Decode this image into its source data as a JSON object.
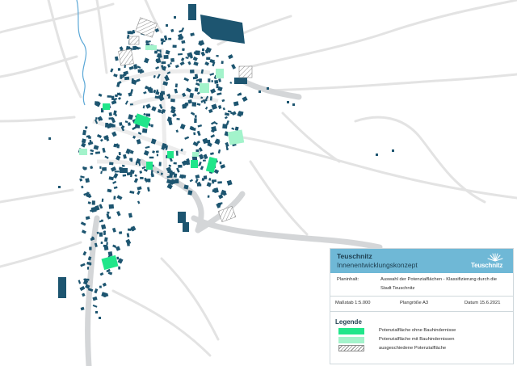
{
  "map": {
    "colors": {
      "background": "#ffffff",
      "roads": "#e3e3e3",
      "main_roads": "#d4d6d8",
      "buildings": "#1d5570",
      "water": "#5aa7d6",
      "potential_free": "#20e68a",
      "potential_obstacles": "#a3f3cb",
      "excluded_hatch": "#8c8c8c"
    }
  },
  "titleblock": {
    "title": "Teuschnitz",
    "subtitle": "Innenentwicklungskonzept",
    "logo_text": "Teuschnitz",
    "plan_label": "Planinhalt:",
    "plan_text_1": "Auswahl der Potenzialflächen - Klassifizierung durch die",
    "plan_text_2": "Stadt Teuschnitz",
    "scale": "Maßstab 1:5.000",
    "size": "Plangröße A3",
    "date": "Datum 15.6.2021",
    "colors": {
      "header": "#6fb8d6",
      "header_text": "#1d3d4e"
    }
  },
  "legend": {
    "title": "Legende",
    "items": [
      {
        "label": "Potenzialfläche ohne Bauhindernisse",
        "swatch": "#20e68a"
      },
      {
        "label": "Potenzialfläche mit Bauhindernissen",
        "swatch": "#a3f3cb"
      },
      {
        "label": "ausgeschiedene Potenzialfläche",
        "swatch": "hatch"
      }
    ]
  }
}
